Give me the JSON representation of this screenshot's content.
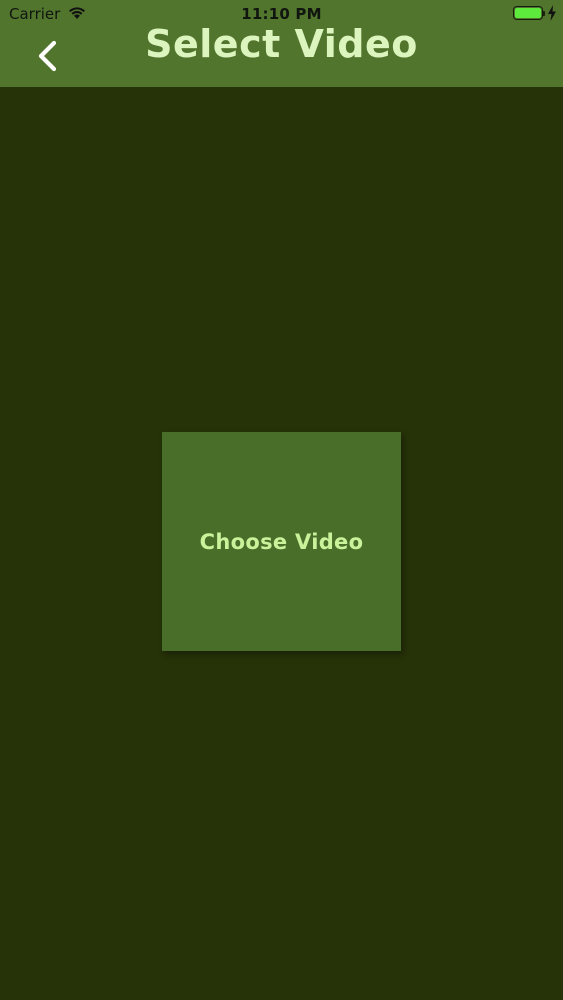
{
  "status_bar": {
    "carrier": "Carrier",
    "time": "11:10 PM",
    "wifi_icon": "wifi-icon",
    "battery_icon": "battery-icon",
    "battery_level": 1.0,
    "charging_icon": "charging-bolt-icon"
  },
  "nav": {
    "title": "Select Video",
    "back_icon": "chevron-left-icon"
  },
  "main": {
    "choose_video_label": "Choose Video"
  },
  "colors": {
    "nav_background": "#52752d",
    "page_background": "#263208",
    "button_background": "#496e2a",
    "title_text": "#dcf5bf",
    "button_text": "#c9f29a",
    "battery_fill": "#5eea3d"
  }
}
